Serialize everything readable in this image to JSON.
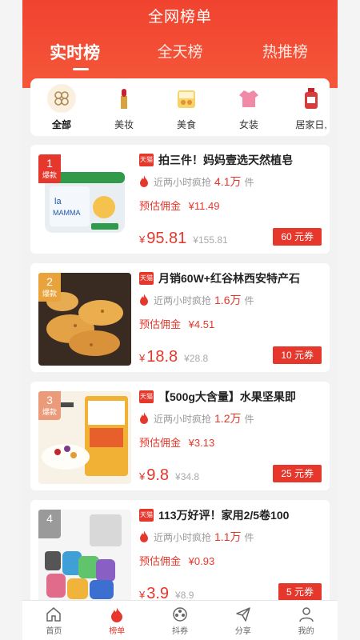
{
  "header": {
    "title": "全网榜单"
  },
  "tabs": [
    {
      "label": "实时榜",
      "active": true
    },
    {
      "label": "全天榜",
      "active": false
    },
    {
      "label": "热推榜",
      "active": false
    }
  ],
  "categories": [
    {
      "label": "全部",
      "icon": "clover-icon",
      "active": true
    },
    {
      "label": "美妆",
      "icon": "lipstick-icon",
      "active": false
    },
    {
      "label": "美食",
      "icon": "food-icon",
      "active": false
    },
    {
      "label": "女装",
      "icon": "dress-icon",
      "active": false
    },
    {
      "label": "居家日,",
      "icon": "detergent-icon",
      "active": false
    }
  ],
  "products": [
    {
      "rank": "1",
      "rank_badge": "爆款",
      "platform": "天猫",
      "title": "拍三件！妈妈壹选天然植皂",
      "sales_prefix": "近两小时疯抢",
      "sales_num": "4.1万",
      "sales_unit": "件",
      "commission_label": "预估佣金",
      "commission": "¥11.49",
      "price_symbol": "¥",
      "price": "95.81",
      "original_price": "¥155.81",
      "coupon": "60 元券"
    },
    {
      "rank": "2",
      "rank_badge": "爆款",
      "platform": "天猫",
      "title": "月销60W+红谷林西安特产石",
      "sales_prefix": "近两小时疯抢",
      "sales_num": "1.6万",
      "sales_unit": "件",
      "commission_label": "预估佣金",
      "commission": "¥4.51",
      "price_symbol": "¥",
      "price": "18.8",
      "original_price": "¥28.8",
      "coupon": "10 元券"
    },
    {
      "rank": "3",
      "rank_badge": "爆款",
      "platform": "天猫",
      "title": "【500g大含量】水果坚果即",
      "sales_prefix": "近两小时疯抢",
      "sales_num": "1.2万",
      "sales_unit": "件",
      "commission_label": "预估佣金",
      "commission": "¥3.13",
      "price_symbol": "¥",
      "price": "9.8",
      "original_price": "¥34.8",
      "coupon": "25 元券"
    },
    {
      "rank": "4",
      "rank_badge": "",
      "platform": "天猫",
      "title": "113万好评！家用2/5卷100",
      "sales_prefix": "近两小时疯抢",
      "sales_num": "1.1万",
      "sales_unit": "件",
      "commission_label": "预估佣金",
      "commission": "¥0.93",
      "price_symbol": "¥",
      "price": "3.9",
      "original_price": "¥8.9",
      "coupon": "5 元券"
    }
  ],
  "tabbar": [
    {
      "label": "首页",
      "icon": "home-icon",
      "active": false
    },
    {
      "label": "榜单",
      "icon": "flame-icon",
      "active": true
    },
    {
      "label": "抖券",
      "icon": "film-reel-icon",
      "active": false
    },
    {
      "label": "分享",
      "icon": "paper-plane-icon",
      "active": false
    },
    {
      "label": "我的",
      "icon": "user-icon",
      "active": false
    }
  ],
  "colors": {
    "brand_red": "#e5372b",
    "header_red": "#f0432f"
  }
}
